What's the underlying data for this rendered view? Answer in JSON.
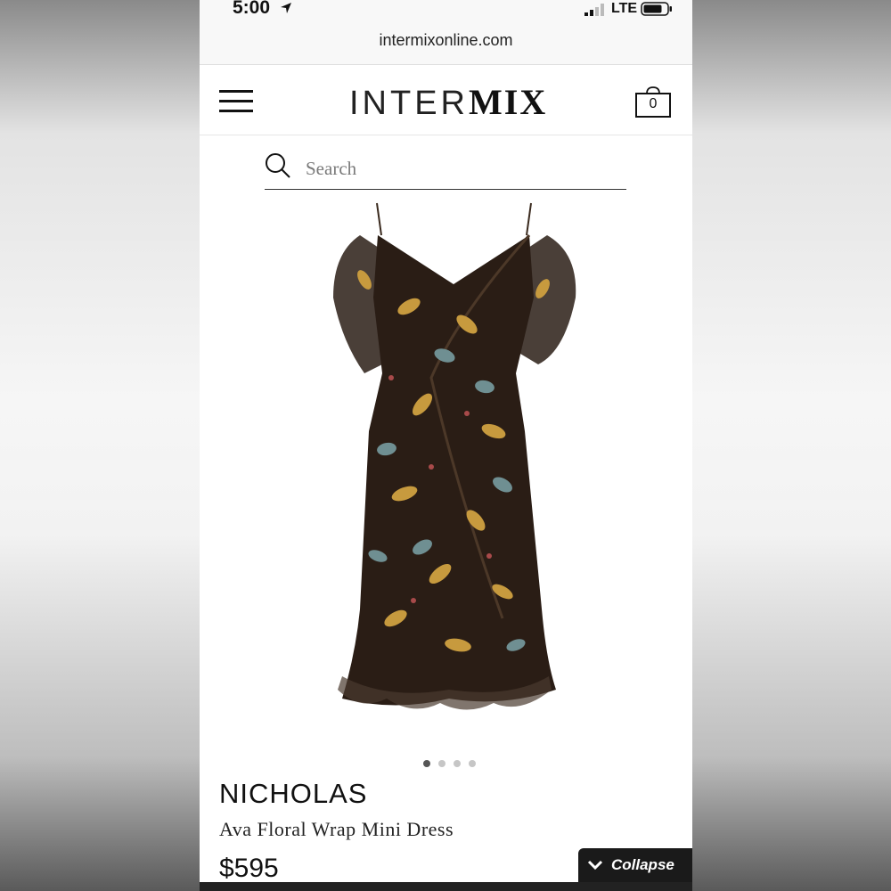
{
  "status_bar": {
    "time": "5:00",
    "network": "LTE"
  },
  "browser": {
    "url": "intermixonline.com"
  },
  "header": {
    "logo_thin": "INTER",
    "logo_bold": "MIX",
    "bag_count": "0"
  },
  "search": {
    "placeholder": "Search"
  },
  "carousel": {
    "total": 4,
    "active_index": 0
  },
  "product": {
    "brand": "NICHOLAS",
    "name": "Ava Floral Wrap Mini Dress",
    "price": "$595"
  },
  "collapse_button": {
    "label": "Collapse"
  },
  "colors": {
    "accent": "#111111",
    "dress_base": "#2a1d15",
    "dress_leaf_gold": "#c79a3e",
    "dress_leaf_teal": "#6f8f92"
  }
}
